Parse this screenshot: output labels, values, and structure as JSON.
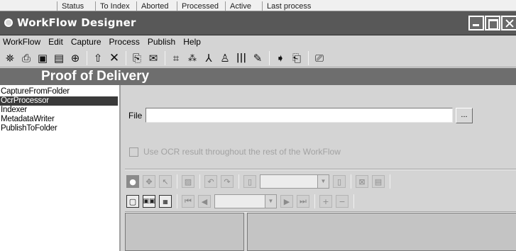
{
  "background_window": {
    "columns": [
      "Status",
      "To Index",
      "Aborted",
      "Processed",
      "Active",
      "Last process"
    ]
  },
  "window": {
    "title": "WorkFlow Designer"
  },
  "menu": [
    "WorkFlow",
    "Edit",
    "Capture",
    "Process",
    "Publish",
    "Help"
  ],
  "toolbar_icons": [
    "new-workflow-icon",
    "open-icon",
    "save-icon",
    "save-as-icon",
    "lock-icon",
    "move-up-icon",
    "delete-icon",
    "capture-folder-icon",
    "capture-email-icon",
    "ocr-icon",
    "ocr-zone-icon",
    "signature-icon",
    "metadata-icon",
    "barcode-icon",
    "spell-check-icon",
    "publish-icon",
    "publish-folder-icon",
    "preview-icon"
  ],
  "project": {
    "title": "Proof of Delivery"
  },
  "steps": [
    {
      "label": "CaptureFromFolder",
      "selected": false
    },
    {
      "label": "OcrProcessor",
      "selected": true
    },
    {
      "label": "Indexer",
      "selected": false
    },
    {
      "label": "MetadataWriter",
      "selected": false
    },
    {
      "label": "PublishToFolder",
      "selected": false
    }
  ],
  "settings": {
    "file_label": "File",
    "file_value": "",
    "browse_label": "...",
    "ocr_checkbox_label": "Use OCR result throughout the rest of the WorkFlow",
    "ocr_checkbox_checked": false,
    "ocr_checkbox_enabled": false
  },
  "ocr_toolbar": {
    "combo_value": ""
  },
  "viewer_toolbar": {
    "page_combo_value": ""
  }
}
